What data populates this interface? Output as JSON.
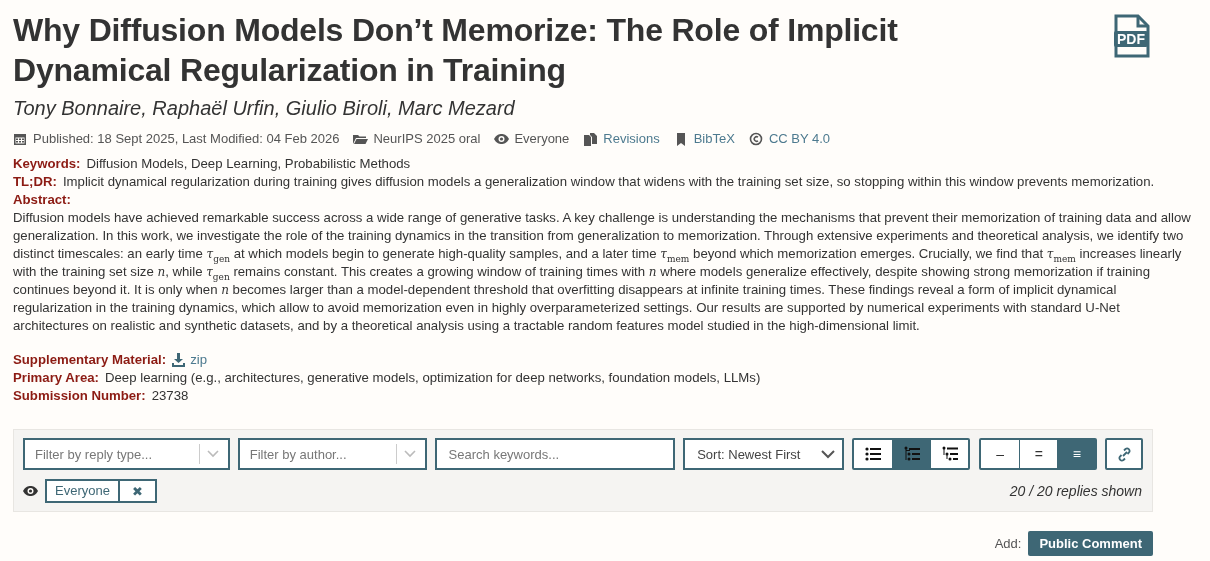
{
  "title": "Why Diffusion Models Don’t Memorize: The Role of Implicit Dynamical Regularization in Training",
  "pdf_label": "PDF",
  "authors": "Tony Bonnaire, Raphaël Urfin, Giulio Biroli, Marc Mezard",
  "meta": [
    {
      "kind": "date",
      "text": "Published: 18 Sept 2025, Last Modified: 04 Feb 2026"
    },
    {
      "kind": "venue",
      "text": "NeurIPS 2025 oral"
    },
    {
      "kind": "readers",
      "text": "Everyone"
    },
    {
      "kind": "revisions",
      "text": "Revisions"
    },
    {
      "kind": "bibtex",
      "text": "BibTeX"
    },
    {
      "kind": "license",
      "text": "CC BY 4.0"
    }
  ],
  "fields": [
    {
      "kind": "inline",
      "label": "Keywords:",
      "value": "Diffusion Models, Deep Learning, Probabilistic Methods"
    },
    {
      "kind": "inline",
      "label": "TL;DR:",
      "value": "Implicit dynamical regularization during training gives diffusion models a generalization window that widens with the training set size, so stopping within this window prevents memorization."
    },
    {
      "kind": "block",
      "label": "Abstract:",
      "value": "Diffusion models have achieved remarkable success across a wide range of generative tasks. A key challenge is understanding the mechanisms that prevent their memorization of training data and allow generalization. In this work, we investigate the role of the training dynamics in the transition from generalization to memorization. Through extensive experiments and theoretical analysis, we identify two distinct timescales: an early time *τ*$_{gen}$ at which models begin to generate high-quality samples, and a later time *τ*$_{mem}$ beyond which memorization emerges. Crucially, we find that *τ*$_{mem}$ increases linearly with the training set size *n*, while *τ*$_{gen}$ remains constant. This creates a growing window of training times with *n* where models generalize effectively, despite showing strong memorization if training continues beyond it. It is only when *n* becomes larger than a model-dependent threshold that overfitting disappears at infinite training times. These findings reveal a form of implicit dynamical regularization in the training dynamics, which allow to avoid memorization even in highly overparameterized settings. Our results are supported by numerical experiments with standard U-Net architectures on realistic and synthetic datasets, and by a theoretical analysis using a tractable random features model studied in the high-dimensional limit."
    },
    {
      "kind": "download",
      "label": "Supplementary Material:",
      "value": "zip"
    },
    {
      "kind": "inline",
      "label": "Primary Area:",
      "value": "Deep learning (e.g., architectures, generative models, optimization for deep networks, foundation models, LLMs)"
    },
    {
      "kind": "inline",
      "label": "Submission Number:",
      "value": "23738"
    }
  ],
  "filters": {
    "reply_type": {
      "placeholder": "Filter by reply type..."
    },
    "author": {
      "placeholder": "Filter by author..."
    },
    "search": {
      "placeholder": "Search keywords..."
    },
    "sort": {
      "value": "Sort: Newest First"
    },
    "view_modes": [
      {
        "kind": "linear",
        "selected": false
      },
      {
        "kind": "threaded",
        "selected": true
      },
      {
        "kind": "nested",
        "selected": false
      }
    ],
    "detail_levels": [
      {
        "label": "–",
        "selected": false
      },
      {
        "label": "=",
        "selected": false
      },
      {
        "label": "≡",
        "selected": true
      }
    ],
    "readers_tag": {
      "label": "Everyone",
      "remove": "✖"
    },
    "count": "20 / 20 replies shown"
  },
  "add": {
    "label": "Add:",
    "button": "Public Comment"
  }
}
